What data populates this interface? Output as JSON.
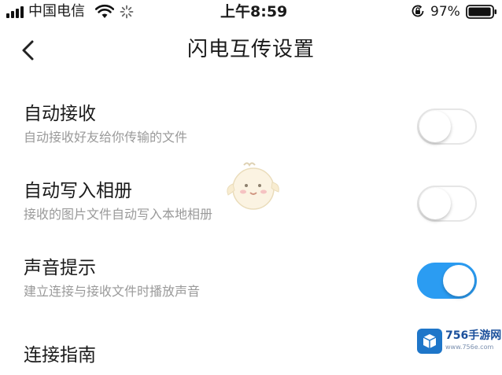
{
  "status_bar": {
    "carrier": "中国电信",
    "time": "上午8:59",
    "battery_percent": "97%",
    "battery_level": 0.97,
    "icons": [
      "signal-icon",
      "wifi-icon",
      "activity-spinner-icon",
      "orientation-lock-icon",
      "battery-icon"
    ]
  },
  "nav": {
    "back_icon": "chevron-left-icon",
    "title": "闪电互传设置"
  },
  "settings": [
    {
      "title": "自动接收",
      "subtitle": "自动接收好友给你传输的文件",
      "enabled": false
    },
    {
      "title": "自动写入相册",
      "subtitle": "接收的图片文件自动写入本地相册",
      "enabled": false
    },
    {
      "title": "声音提示",
      "subtitle": "建立连接与接收文件时播放声音",
      "enabled": true
    }
  ],
  "guide": {
    "label": "连接指南"
  },
  "watermark": {
    "name": "756手游网",
    "url": "www.756e.com"
  },
  "colors": {
    "toggle_on": "#2b9cf2",
    "toggle_off_border": "#e6e6e6",
    "subtitle_text": "#9a9a9a"
  }
}
